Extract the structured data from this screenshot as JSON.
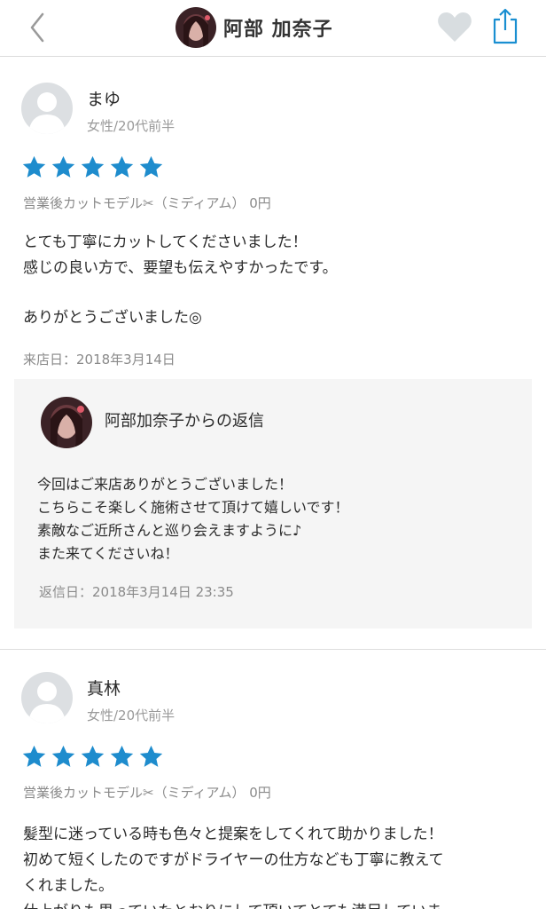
{
  "header": {
    "title": "阿部 加奈子",
    "back_icon": "chevron-left-icon",
    "favorite_icon": "heart-icon",
    "share_icon": "share-icon",
    "accent_color": "#1a8fd1"
  },
  "reviews": [
    {
      "name": "まゆ",
      "meta": "女性/20代前半",
      "rating": 5,
      "menu": "営業後カットモデル✂︎（ミディアム） 0円",
      "body": [
        "とても丁寧にカットしてくださいました！",
        "感じの良い方で、要望も伝えやすかったです。",
        "",
        "ありがとうございました◎"
      ],
      "visit_date": "来店日：2018年3月14日",
      "reply": {
        "title": "阿部加奈子からの返信",
        "body": [
          "今回はご来店ありがとうございました！",
          "こちらこそ楽しく施術させて頂けて嬉しいです！",
          "素敵なご近所さんと巡り会えますように♪",
          "また来てくださいね！"
        ],
        "date": "返信日：2018年3月14日 23:35"
      }
    },
    {
      "name": "真林",
      "meta": "女性/20代前半",
      "rating": 5,
      "menu": "営業後カットモデル✂︎（ミディアム） 0円",
      "body": [
        "髪型に迷っている時も色々と提案をしてくれて助かりました！",
        "初めて短くしたのですがドライヤーの仕方なども丁寧に教えて",
        "くれました。",
        "仕上がりも思っていたとおりにして頂いてとても満足していま"
      ]
    }
  ],
  "star_color": "#1e8ccd"
}
